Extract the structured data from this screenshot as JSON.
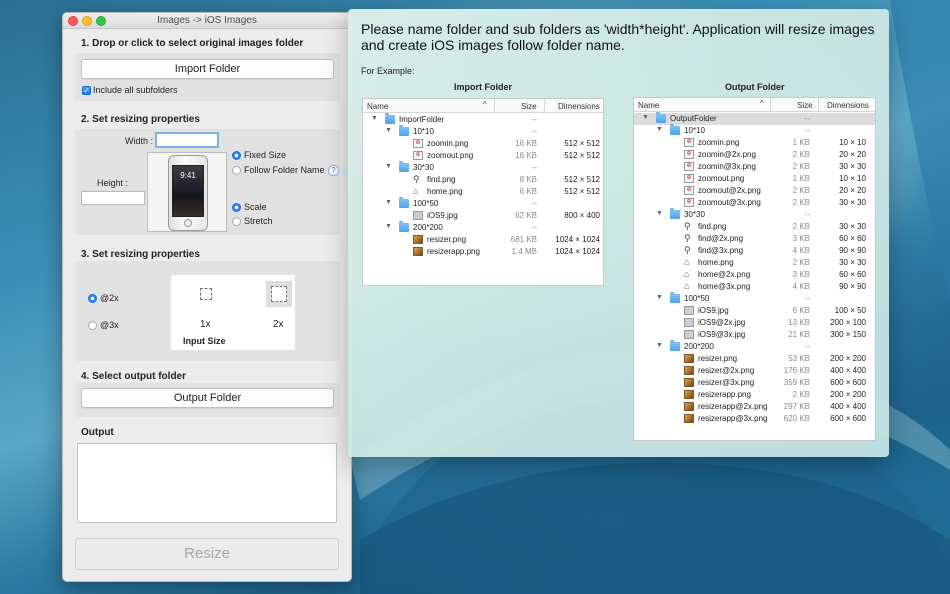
{
  "window": {
    "title": "Images -> iOS Images"
  },
  "step1": {
    "heading": "1. Drop or click to select original images folder",
    "import_button": "Import Folder",
    "include_subfolders": "Include all subfolders"
  },
  "step2": {
    "heading": "2. Set resizing properties",
    "width_label": "Width :",
    "height_label": "Height :",
    "fixed_size": "Fixed Size",
    "follow_folder_name": "Follow Folder Name",
    "scale": "Scale",
    "stretch": "Stretch",
    "help_glyph": "?",
    "phone_time": "9:41"
  },
  "step3": {
    "heading": "3. Set resizing properties",
    "opt_2x": "@2x",
    "opt_3x": "@3x",
    "label_1x": "1x",
    "label_2x": "2x",
    "input_size": "Input Size"
  },
  "step4": {
    "heading": "4. Select output folder",
    "output_button": "Output Folder"
  },
  "output": {
    "heading": "Output"
  },
  "resize_button": "Resize",
  "popover": {
    "message": "Please name folder and sub folders as 'width*height'. Application will resize images and create iOS images follow folder name.",
    "example": "For Example:",
    "import_title": "Import Folder",
    "output_title": "Output Folder",
    "col_name": "Name",
    "col_size": "Size",
    "col_dim": "Dimensions",
    "sort_glyph": "^"
  },
  "import_tree": [
    {
      "level": 0,
      "type": "folder",
      "name": "ImportFolder",
      "size": "--",
      "dim": ""
    },
    {
      "level": 1,
      "type": "folder",
      "name": "10*10",
      "size": "--",
      "dim": ""
    },
    {
      "level": 2,
      "type": "zoom",
      "name": "zoomin.png",
      "size": "16 KB",
      "dim": "512 × 512"
    },
    {
      "level": 2,
      "type": "zoom",
      "name": "zoomout.png",
      "size": "16 KB",
      "dim": "512 × 512"
    },
    {
      "level": 1,
      "type": "folder",
      "name": "30*30",
      "size": "--",
      "dim": ""
    },
    {
      "level": 2,
      "type": "search",
      "name": "find.png",
      "size": "8 KB",
      "dim": "512 × 512"
    },
    {
      "level": 2,
      "type": "home",
      "name": "home.png",
      "size": "6 KB",
      "dim": "512 × 512"
    },
    {
      "level": 1,
      "type": "folder",
      "name": "100*50",
      "size": "--",
      "dim": ""
    },
    {
      "level": 2,
      "type": "ios",
      "name": "iOS9.jpg",
      "size": "62 KB",
      "dim": "800 × 400"
    },
    {
      "level": 1,
      "type": "folder",
      "name": "200*200",
      "size": "--",
      "dim": ""
    },
    {
      "level": 2,
      "type": "img",
      "name": "resizer.png",
      "size": "681 KB",
      "dim": "1024 × 1024"
    },
    {
      "level": 2,
      "type": "img",
      "name": "resizerapp.png",
      "size": "1.4 MB",
      "dim": "1024 × 1024"
    }
  ],
  "output_tree": [
    {
      "level": 0,
      "type": "folder",
      "name": "OutputFolder",
      "size": "--",
      "dim": ""
    },
    {
      "level": 1,
      "type": "folder",
      "name": "10*10",
      "size": "--",
      "dim": ""
    },
    {
      "level": 2,
      "type": "zoom",
      "name": "zoomin.png",
      "size": "1 KB",
      "dim": "10 × 10"
    },
    {
      "level": 2,
      "type": "zoom",
      "name": "zoomin@2x.png",
      "size": "2 KB",
      "dim": "20 × 20"
    },
    {
      "level": 2,
      "type": "zoom",
      "name": "zoomin@3x.png",
      "size": "2 KB",
      "dim": "30 × 30"
    },
    {
      "level": 2,
      "type": "zoom",
      "name": "zoomout.png",
      "size": "1 KB",
      "dim": "10 × 10"
    },
    {
      "level": 2,
      "type": "zoom",
      "name": "zoomout@2x.png",
      "size": "2 KB",
      "dim": "20 × 20"
    },
    {
      "level": 2,
      "type": "zoom",
      "name": "zoomout@3x.png",
      "size": "2 KB",
      "dim": "30 × 30"
    },
    {
      "level": 1,
      "type": "folder",
      "name": "30*30",
      "size": "--",
      "dim": ""
    },
    {
      "level": 2,
      "type": "search",
      "name": "find.png",
      "size": "2 KB",
      "dim": "30 × 30"
    },
    {
      "level": 2,
      "type": "search",
      "name": "find@2x.png",
      "size": "3 KB",
      "dim": "60 × 60"
    },
    {
      "level": 2,
      "type": "search",
      "name": "find@3x.png",
      "size": "4 KB",
      "dim": "90 × 90"
    },
    {
      "level": 2,
      "type": "home",
      "name": "home.png",
      "size": "2 KB",
      "dim": "30 × 30"
    },
    {
      "level": 2,
      "type": "home",
      "name": "home@2x.png",
      "size": "3 KB",
      "dim": "60 × 60"
    },
    {
      "level": 2,
      "type": "home",
      "name": "home@3x.png",
      "size": "4 KB",
      "dim": "90 × 90"
    },
    {
      "level": 1,
      "type": "folder",
      "name": "100*50",
      "size": "--",
      "dim": ""
    },
    {
      "level": 2,
      "type": "ios",
      "name": "iOS9.jpg",
      "size": "6 KB",
      "dim": "100 × 50"
    },
    {
      "level": 2,
      "type": "ios",
      "name": "iOS9@2x.jpg",
      "size": "13 KB",
      "dim": "200 × 100"
    },
    {
      "level": 2,
      "type": "ios",
      "name": "iOS9@3x.jpg",
      "size": "21 KB",
      "dim": "300 × 150"
    },
    {
      "level": 1,
      "type": "folder",
      "name": "200*200",
      "size": "--",
      "dim": ""
    },
    {
      "level": 2,
      "type": "img",
      "name": "resizer.png",
      "size": "53 KB",
      "dim": "200 × 200"
    },
    {
      "level": 2,
      "type": "img",
      "name": "resizer@2x.png",
      "size": "176 KB",
      "dim": "400 × 400"
    },
    {
      "level": 2,
      "type": "img",
      "name": "resizer@3x.png",
      "size": "359 KB",
      "dim": "600 × 600"
    },
    {
      "level": 2,
      "type": "img",
      "name": "resizerapp.png",
      "size": "2 KB",
      "dim": "200 × 200"
    },
    {
      "level": 2,
      "type": "img",
      "name": "resizerapp@2x.png",
      "size": "297 KB",
      "dim": "400 × 400"
    },
    {
      "level": 2,
      "type": "img",
      "name": "resizerapp@3x.png",
      "size": "620 KB",
      "dim": "600 × 600"
    }
  ],
  "colors": {
    "accent": "#2b84ee",
    "folder": "#5aaeee"
  }
}
